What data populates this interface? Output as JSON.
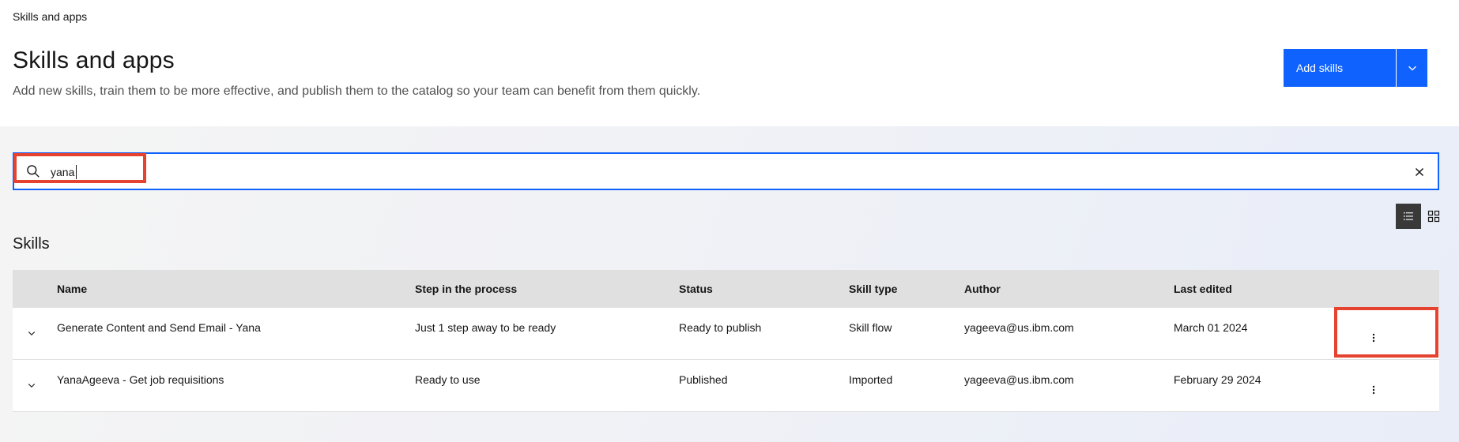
{
  "breadcrumb": "Skills and apps",
  "header": {
    "title": "Skills and apps",
    "subtitle": "Add new skills, train them to be more effective, and publish them to the catalog so your team can benefit from them quickly.",
    "add_button": "Add skills"
  },
  "search": {
    "value": "yana",
    "placeholder": ""
  },
  "skills": {
    "title": "Skills",
    "columns": {
      "name": "Name",
      "step": "Step in the process",
      "status": "Status",
      "type": "Skill type",
      "author": "Author",
      "edited": "Last edited"
    },
    "rows": [
      {
        "name": "Generate Content and Send Email - Yana",
        "step": "Just 1 step away to be ready",
        "status": "Ready to publish",
        "type": "Skill flow",
        "author": "yageeva@us.ibm.com",
        "edited": "March 01 2024"
      },
      {
        "name": "YanaAgeeva - Get job requisitions",
        "step": "Ready to use",
        "status": "Published",
        "type": "Imported",
        "author": "yageeva@us.ibm.com",
        "edited": "February 29 2024"
      }
    ]
  },
  "icons": {
    "search": "search-icon",
    "clear": "close-icon",
    "list_view": "list-view-icon",
    "grid_view": "grid-view-icon",
    "expand": "chevron-down-icon",
    "overflow": "overflow-menu-icon"
  },
  "colors": {
    "accent": "#0f62fe",
    "highlight": "#e5432f"
  }
}
